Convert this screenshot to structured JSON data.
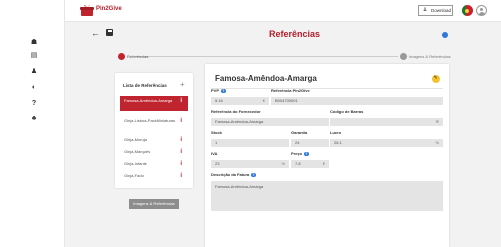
{
  "app": {
    "name": "Pin2Give"
  },
  "topbar": {
    "download_label": "Download",
    "download_icon": "download-icon"
  },
  "sidebar": {
    "icons": [
      "home-icon",
      "grid-icon",
      "user-icon",
      "shield-icon",
      "help-icon",
      "team-icon"
    ],
    "glyphs": [
      "☗",
      "▤",
      "♟",
      "◐",
      "?",
      "♣"
    ]
  },
  "page": {
    "title": "Referências"
  },
  "stepper": {
    "step1": "Referências",
    "step2": "Imagens & Referências"
  },
  "list": {
    "title": "Lista de Referências",
    "add": "+",
    "items": [
      {
        "label": "Famosa-Amêndoa-Amarga",
        "active": true
      },
      {
        "label": "Ginja-Lisboa-PackMiniaturas",
        "active": false
      },
      {
        "label": "Ginja-Moruja",
        "active": false
      },
      {
        "label": "Ginja-Marquês",
        "active": false
      },
      {
        "label": "Ginja-Infante",
        "active": false
      },
      {
        "label": "Ginja-Fado",
        "active": false
      }
    ],
    "info_glyph": "i"
  },
  "images_button": "Imagens & Referências",
  "detail": {
    "title": "Famosa-Amêndoa-Amarga",
    "pvp": {
      "label": "PVP",
      "value": "5.16",
      "suffix": "€"
    },
    "ref_pin2give": {
      "label": "Referência Pin2Give",
      "value": "B004700001"
    },
    "ref_fornecedor": {
      "label": "Referência do Fornecedor",
      "value": "Famosa-Amêndoa-Amarga"
    },
    "barcode": {
      "label": "Código de Barras",
      "value": "",
      "suffix": "✉"
    },
    "stock": {
      "label": "Stock",
      "value": "1"
    },
    "garantia": {
      "label": "Garantia",
      "value": "24"
    },
    "lucro": {
      "label": "Lucro",
      "value": "26.1",
      "suffix": "%"
    },
    "iva": {
      "label": "IVA",
      "value": "23",
      "suffix": "%"
    },
    "preco": {
      "label": "Preço",
      "value": "7.8",
      "suffix": "€"
    },
    "descricao": {
      "label": "Descrição da Fatura",
      "value": "Famosa-Amêndoa-Amarga"
    }
  },
  "colors": {
    "brand": "#b21e2c",
    "accent_blue": "#2f78d8",
    "edit_yellow": "#f3c22d"
  }
}
